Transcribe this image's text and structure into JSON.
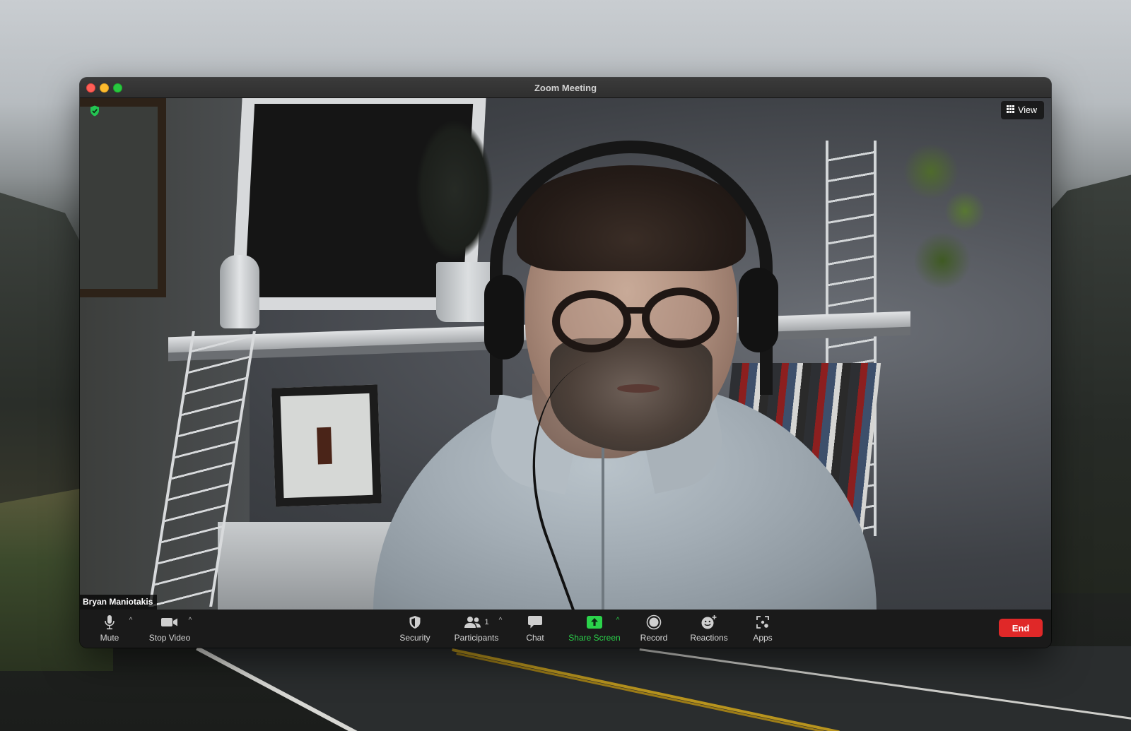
{
  "window": {
    "title": "Zoom Meeting"
  },
  "video": {
    "participant_name": "Bryan Maniotakis",
    "view_label": "View",
    "encryption_badge": "shield-check-icon"
  },
  "toolbar": {
    "mute_label": "Mute",
    "stop_video_label": "Stop Video",
    "security_label": "Security",
    "participants_label": "Participants",
    "participants_count": "1",
    "chat_label": "Chat",
    "share_screen_label": "Share Screen",
    "record_label": "Record",
    "reactions_label": "Reactions",
    "apps_label": "Apps",
    "end_label": "End"
  },
  "colors": {
    "end_button": "#e02828",
    "share_accent": "#2bd34b",
    "toolbar_bg": "#1a1a1a",
    "encryption_green": "#23c552"
  },
  "icons": {
    "mute": "microphone-icon",
    "stop_video": "video-camera-icon",
    "security": "shield-icon",
    "participants": "people-icon",
    "chat": "chat-bubble-icon",
    "share_screen": "share-arrow-icon",
    "record": "record-icon",
    "reactions": "smiley-plus-icon",
    "apps": "apps-icon",
    "view": "grid-icon"
  }
}
